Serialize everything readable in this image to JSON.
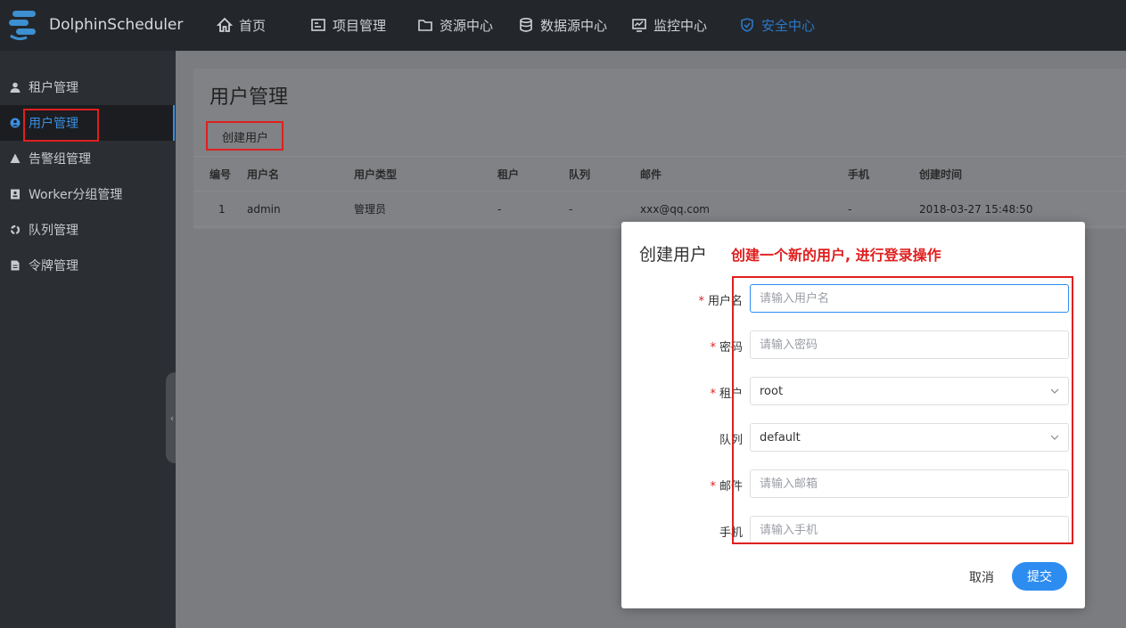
{
  "app": {
    "brand": "DolphinScheduler"
  },
  "topnav": [
    {
      "label": "首页",
      "icon": "home-icon"
    },
    {
      "label": "项目管理",
      "icon": "project-icon"
    },
    {
      "label": "资源中心",
      "icon": "folder-icon"
    },
    {
      "label": "数据源中心",
      "icon": "database-icon"
    },
    {
      "label": "监控中心",
      "icon": "monitor-icon"
    },
    {
      "label": "安全中心",
      "icon": "shield-icon",
      "active": true
    }
  ],
  "sidebar": [
    {
      "label": "租户管理",
      "icon": "user-icon"
    },
    {
      "label": "用户管理",
      "icon": "user-circle-icon",
      "active": true
    },
    {
      "label": "告警组管理",
      "icon": "warning-icon"
    },
    {
      "label": "Worker分组管理",
      "icon": "id-card-icon"
    },
    {
      "label": "队列管理",
      "icon": "recycle-icon"
    },
    {
      "label": "令牌管理",
      "icon": "document-icon"
    }
  ],
  "page": {
    "title": "用户管理",
    "create_button": "创建用户"
  },
  "table": {
    "headers": [
      "编号",
      "用户名",
      "用户类型",
      "租户",
      "队列",
      "邮件",
      "手机",
      "创建时间"
    ],
    "rows": [
      [
        "1",
        "admin",
        "管理员",
        "-",
        "-",
        "xxx@qq.com",
        "-",
        "2018-03-27 15:48:50"
      ]
    ]
  },
  "modal": {
    "title": "创建用户",
    "annotation": "创建一个新的用户, 进行登录操作",
    "fields": {
      "username": {
        "label": "用户名",
        "required": "*",
        "placeholder": "请输入用户名"
      },
      "password": {
        "label": "密码",
        "required": "*",
        "placeholder": "请输入密码"
      },
      "tenant": {
        "label": "租户",
        "required": "*",
        "value": "root"
      },
      "queue": {
        "label": "队列",
        "value": "default"
      },
      "email": {
        "label": "邮件",
        "required": "*",
        "placeholder": "请输入邮箱"
      },
      "phone": {
        "label": "手机",
        "placeholder": "请输入手机"
      }
    },
    "cancel": "取消",
    "submit": "提交"
  },
  "colors": {
    "accent": "#2d8cf0",
    "annotation_red": "#e01f1f",
    "nav_bg": "#23262b",
    "sidebar_bg": "#2b2e33"
  }
}
